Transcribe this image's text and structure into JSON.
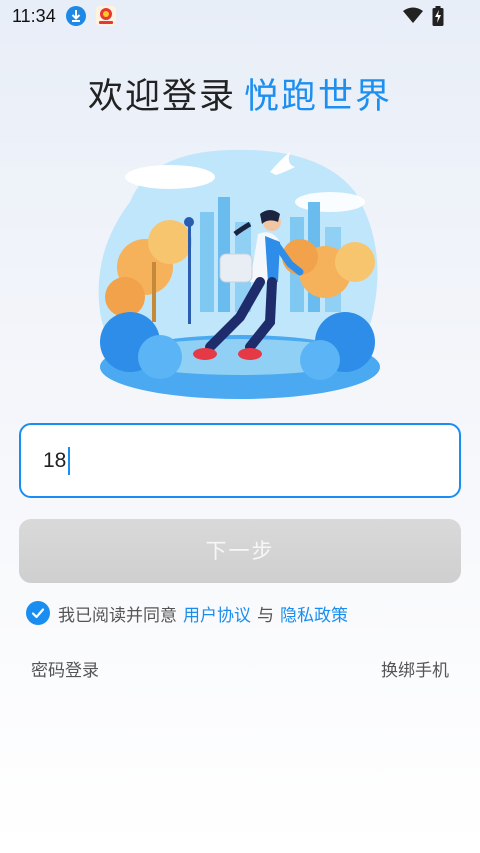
{
  "status_bar": {
    "time": "11:34",
    "icons": [
      "download-icon",
      "app-notification-icon",
      "wifi-icon",
      "battery-charging-icon"
    ]
  },
  "header": {
    "welcome": "欢迎登录",
    "app_name": "悦跑世界"
  },
  "illustration": {
    "description_icon": "runner-illustration"
  },
  "form": {
    "phone_value": "18"
  },
  "buttons": {
    "next_label": "下一步"
  },
  "agreement": {
    "checked": true,
    "prefix": "我已阅读并同意",
    "user_agreement": "用户协议",
    "conjunction": "与",
    "privacy_policy": "隐私政策"
  },
  "links": {
    "password_login": "密码登录",
    "rebind_phone": "换绑手机"
  },
  "colors": {
    "accent": "#1a8ef0",
    "disabled_button": "#d3d3d3"
  }
}
